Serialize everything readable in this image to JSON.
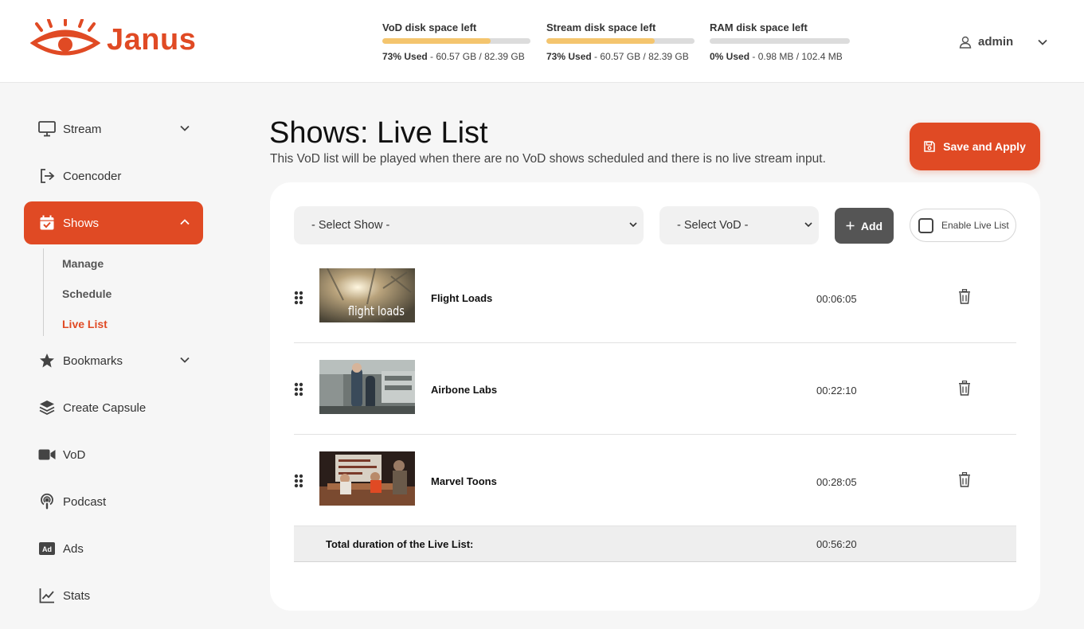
{
  "header": {
    "brand": "Janus",
    "disks": [
      {
        "title": "VoD disk space left",
        "used_label": "73% Used",
        "detail": " - 60.57 GB / 82.39 GB",
        "used_fraction": 0.73
      },
      {
        "title": "Stream disk space left",
        "used_label": "73% Used",
        "detail": " - 60.57 GB / 82.39 GB",
        "used_fraction": 0.73
      },
      {
        "title": "RAM disk space left",
        "used_label": "0% Used",
        "detail": " - 0.98 MB / 102.4 MB",
        "used_fraction": 0.0
      }
    ],
    "user": {
      "name": "admin",
      "icon": "user-icon"
    }
  },
  "sidebar": {
    "items": [
      {
        "label": "Stream",
        "icon": "monitor-icon"
      },
      {
        "label": "Coencoder",
        "icon": "sign-in-icon"
      },
      {
        "label": "Shows",
        "icon": "calendar-check-icon"
      },
      {
        "label": "Bookmarks",
        "icon": "star-icon"
      },
      {
        "label": "Create Capsule",
        "icon": "layers-icon"
      },
      {
        "label": "VoD",
        "icon": "video-camera-icon"
      },
      {
        "label": "Podcast",
        "icon": "podcast-icon"
      },
      {
        "label": "Ads",
        "icon": "ad-icon"
      },
      {
        "label": "Stats",
        "icon": "chart-line-icon"
      }
    ],
    "shows_sub": [
      {
        "label": "Manage"
      },
      {
        "label": "Schedule"
      },
      {
        "label": "Live List"
      }
    ]
  },
  "main": {
    "title": "Shows: Live List",
    "description": "This VoD list will be played when there are no VoD shows scheduled and there is no live stream input.",
    "save_label": "Save and Apply",
    "select_show": "- Select Show -",
    "select_vod": "- Select VoD -",
    "add_label": "Add",
    "enable_label": "Enable Live List",
    "rows": [
      {
        "name": "Flight Loads",
        "duration": "00:06:05",
        "thumb_caption": "flight loads"
      },
      {
        "name": "Airbone Labs",
        "duration": "00:22:10",
        "thumb_caption": ""
      },
      {
        "name": "Marvel Toons",
        "duration": "00:28:05",
        "thumb_caption": ""
      }
    ],
    "total_label": "Total duration of the Live List:",
    "total_value": "00:56:20"
  },
  "colors": {
    "accent": "#e04a24",
    "bar_fill": "#f4c56e",
    "bar_track": "#dcdcdc"
  }
}
